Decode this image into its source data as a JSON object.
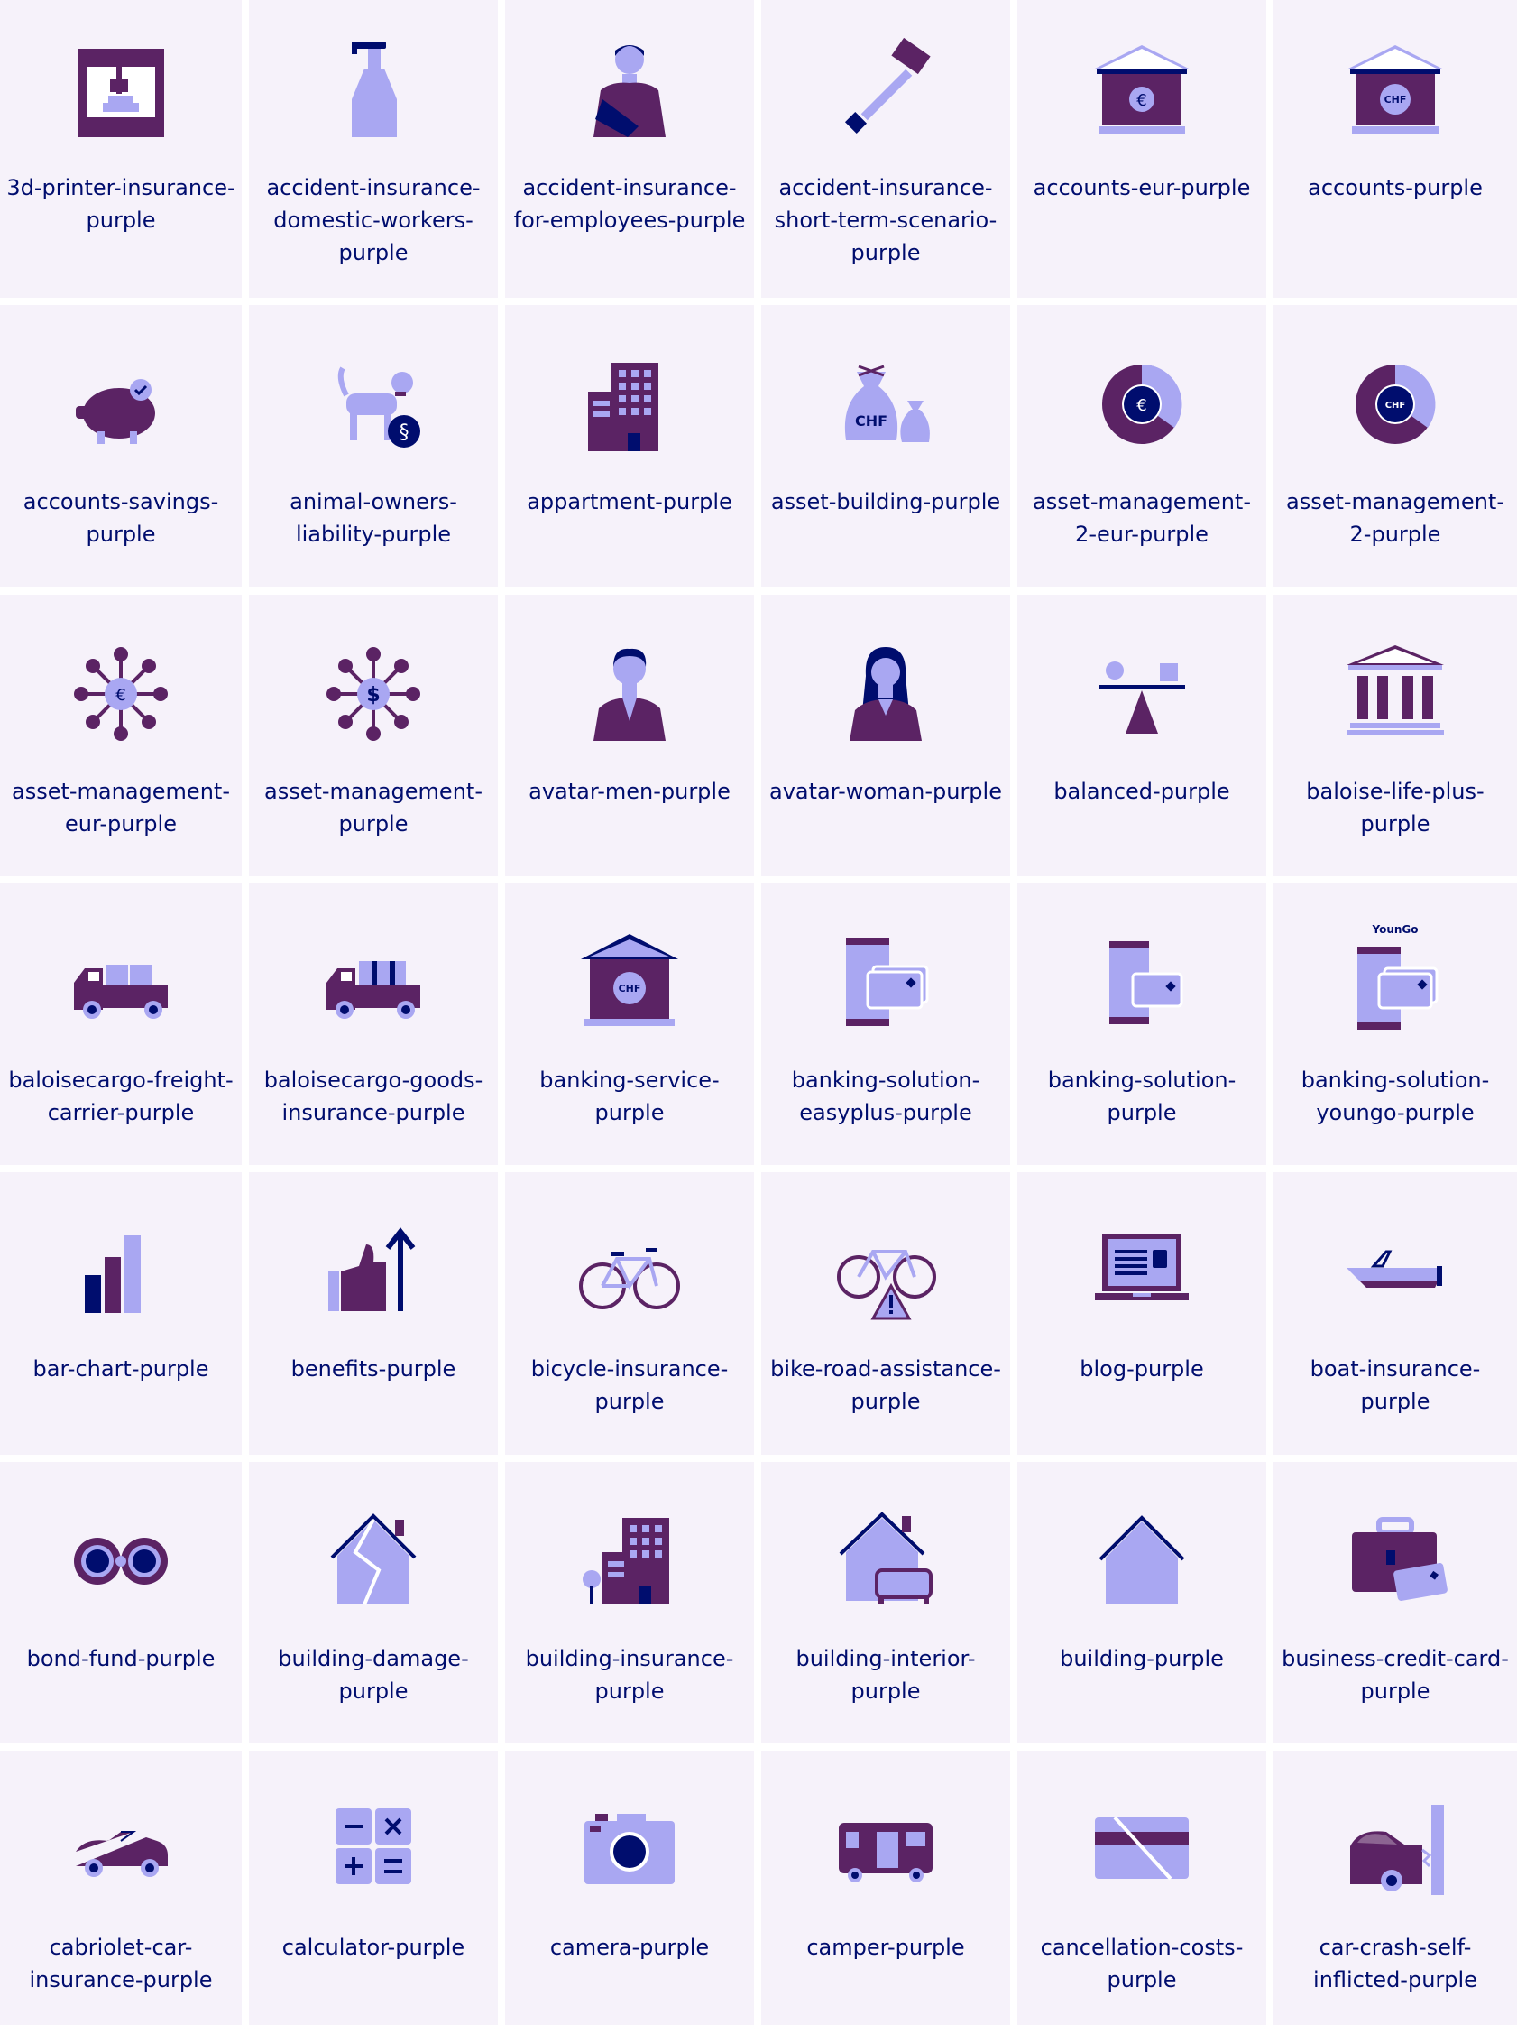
{
  "colors": {
    "tile_background": "#f6f2fa",
    "label_text": "#000d6e",
    "icon_dark_purple": "#5b2364",
    "icon_light_purple": "#a9a7f2",
    "icon_navy": "#000d6e"
  },
  "tiles": [
    {
      "label": "3d-printer-insurance-purple",
      "icon": "3d-printer-icon"
    },
    {
      "label": "accident-insurance-domestic-workers-purple",
      "icon": "spray-bottle-icon"
    },
    {
      "label": "accident-insurance-for-employees-purple",
      "icon": "injured-person-icon"
    },
    {
      "label": "accident-insurance-short-term-scenario-purple",
      "icon": "hammer-icon"
    },
    {
      "label": "accounts-eur-purple",
      "icon": "bank-eur-icon"
    },
    {
      "label": "accounts-purple",
      "icon": "bank-chf-icon"
    },
    {
      "label": "accounts-savings-purple",
      "icon": "piggy-bank-icon"
    },
    {
      "label": "animal-owners-liability-purple",
      "icon": "dog-paragraph-icon"
    },
    {
      "label": "appartment-purple",
      "icon": "apartment-building-icon"
    },
    {
      "label": "asset-building-purple",
      "icon": "money-bags-chf-icon"
    },
    {
      "label": "asset-management-2-eur-purple",
      "icon": "donut-eur-icon"
    },
    {
      "label": "asset-management-2-purple",
      "icon": "donut-chf-icon"
    },
    {
      "label": "asset-management-eur-purple",
      "icon": "network-eur-icon"
    },
    {
      "label": "asset-management-purple",
      "icon": "network-dollar-icon"
    },
    {
      "label": "avatar-men-purple",
      "icon": "avatar-man-icon"
    },
    {
      "label": "avatar-woman-purple",
      "icon": "avatar-woman-icon"
    },
    {
      "label": "balanced-purple",
      "icon": "balance-scale-icon"
    },
    {
      "label": "baloise-life-plus-purple",
      "icon": "classical-building-icon"
    },
    {
      "label": "baloisecargo-freight-carrier-purple",
      "icon": "freight-truck-icon"
    },
    {
      "label": "baloisecargo-goods-insurance-purple",
      "icon": "goods-truck-icon"
    },
    {
      "label": "banking-service-purple",
      "icon": "bank-chf-service-icon"
    },
    {
      "label": "banking-solution-easyplus-purple",
      "icon": "phone-card-icon"
    },
    {
      "label": "banking-solution-purple",
      "icon": "phone-card-small-icon"
    },
    {
      "label": "banking-solution-youngo-purple",
      "icon": "phone-card-youngo-icon",
      "brand": "YounGo"
    },
    {
      "label": "bar-chart-purple",
      "icon": "bar-chart-icon"
    },
    {
      "label": "benefits-purple",
      "icon": "thumbs-up-arrow-icon"
    },
    {
      "label": "bicycle-insurance-purple",
      "icon": "bicycle-icon"
    },
    {
      "label": "bike-road-assistance-purple",
      "icon": "bicycle-warning-icon"
    },
    {
      "label": "blog-purple",
      "icon": "laptop-icon"
    },
    {
      "label": "boat-insurance-purple",
      "icon": "boat-icon"
    },
    {
      "label": "bond-fund-purple",
      "icon": "binoculars-icon"
    },
    {
      "label": "building-damage-purple",
      "icon": "cracked-house-icon"
    },
    {
      "label": "building-insurance-purple",
      "icon": "office-building-tree-icon"
    },
    {
      "label": "building-interior-purple",
      "icon": "house-sofa-icon"
    },
    {
      "label": "building-purple",
      "icon": "house-icon"
    },
    {
      "label": "business-credit-card-purple",
      "icon": "briefcase-card-icon"
    },
    {
      "label": "cabriolet-car-insurance-purple",
      "icon": "cabriolet-icon"
    },
    {
      "label": "calculator-purple",
      "icon": "calculator-icon"
    },
    {
      "label": "camera-purple",
      "icon": "camera-icon"
    },
    {
      "label": "camper-purple",
      "icon": "camper-icon"
    },
    {
      "label": "cancellation-costs-purple",
      "icon": "crossed-card-icon"
    },
    {
      "label": "car-crash-self-inflicted-purple",
      "icon": "car-crash-icon"
    }
  ]
}
